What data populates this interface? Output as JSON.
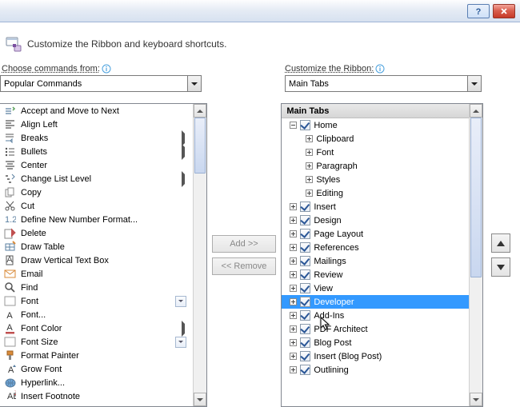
{
  "header": {
    "text": "Customize the Ribbon and keyboard shortcuts."
  },
  "left": {
    "label": "Choose commands from:",
    "combo": "Popular Commands",
    "items": [
      {
        "name": "Accept and Move to Next",
        "icon": "accept",
        "sub": false
      },
      {
        "name": "Align Left",
        "icon": "align-left",
        "sub": false
      },
      {
        "name": "Breaks",
        "icon": "breaks",
        "sub": true
      },
      {
        "name": "Bullets",
        "icon": "bullets",
        "sub": true
      },
      {
        "name": "Center",
        "icon": "center",
        "sub": false
      },
      {
        "name": "Change List Level",
        "icon": "list-level",
        "sub": true
      },
      {
        "name": "Copy",
        "icon": "copy",
        "sub": false
      },
      {
        "name": "Cut",
        "icon": "cut",
        "sub": false
      },
      {
        "name": "Define New Number Format...",
        "icon": "number",
        "sub": false
      },
      {
        "name": "Delete",
        "icon": "delete",
        "sub": false
      },
      {
        "name": "Draw Table",
        "icon": "draw-table",
        "sub": false
      },
      {
        "name": "Draw Vertical Text Box",
        "icon": "vtextbox",
        "sub": false
      },
      {
        "name": "Email",
        "icon": "email",
        "sub": false
      },
      {
        "name": "Find",
        "icon": "find",
        "sub": false
      },
      {
        "name": "Font",
        "icon": "font",
        "sub": false,
        "dd": true
      },
      {
        "name": "Font...",
        "icon": "font-a",
        "sub": false
      },
      {
        "name": "Font Color",
        "icon": "font-color",
        "sub": true
      },
      {
        "name": "Font Size",
        "icon": "font-size",
        "sub": false,
        "dd": true
      },
      {
        "name": "Format Painter",
        "icon": "painter",
        "sub": false
      },
      {
        "name": "Grow Font",
        "icon": "grow",
        "sub": false
      },
      {
        "name": "Hyperlink...",
        "icon": "hyperlink",
        "sub": false
      },
      {
        "name": "Insert Footnote",
        "icon": "footnote",
        "sub": false
      }
    ]
  },
  "right": {
    "label": "Customize the Ribbon:",
    "combo": "Main Tabs",
    "header": "Main Tabs",
    "tree": [
      {
        "lvl": 1,
        "pm": "minus",
        "cb": true,
        "label": "Home"
      },
      {
        "lvl": 2,
        "pm": "plus",
        "cb": false,
        "label": "Clipboard"
      },
      {
        "lvl": 2,
        "pm": "plus",
        "cb": false,
        "label": "Font"
      },
      {
        "lvl": 2,
        "pm": "plus",
        "cb": false,
        "label": "Paragraph"
      },
      {
        "lvl": 2,
        "pm": "plus",
        "cb": false,
        "label": "Styles"
      },
      {
        "lvl": 2,
        "pm": "plus",
        "cb": false,
        "label": "Editing"
      },
      {
        "lvl": 1,
        "pm": "plus",
        "cb": true,
        "label": "Insert"
      },
      {
        "lvl": 1,
        "pm": "plus",
        "cb": true,
        "label": "Design"
      },
      {
        "lvl": 1,
        "pm": "plus",
        "cb": true,
        "label": "Page Layout"
      },
      {
        "lvl": 1,
        "pm": "plus",
        "cb": true,
        "label": "References"
      },
      {
        "lvl": 1,
        "pm": "plus",
        "cb": true,
        "label": "Mailings"
      },
      {
        "lvl": 1,
        "pm": "plus",
        "cb": true,
        "label": "Review"
      },
      {
        "lvl": 1,
        "pm": "plus",
        "cb": true,
        "label": "View"
      },
      {
        "lvl": 1,
        "pm": "plus",
        "cb": true,
        "label": "Developer",
        "selected": true
      },
      {
        "lvl": 1,
        "pm": "plus",
        "cb": true,
        "label": "Add-Ins"
      },
      {
        "lvl": 1,
        "pm": "plus",
        "cb": true,
        "label": "PDF Architect"
      },
      {
        "lvl": 1,
        "pm": "plus",
        "cb": true,
        "label": "Blog Post"
      },
      {
        "lvl": 1,
        "pm": "plus",
        "cb": true,
        "label": "Insert (Blog Post)"
      },
      {
        "lvl": 1,
        "pm": "plus",
        "cb": true,
        "label": "Outlining"
      }
    ]
  },
  "buttons": {
    "add": "Add >>",
    "remove": "<< Remove"
  }
}
